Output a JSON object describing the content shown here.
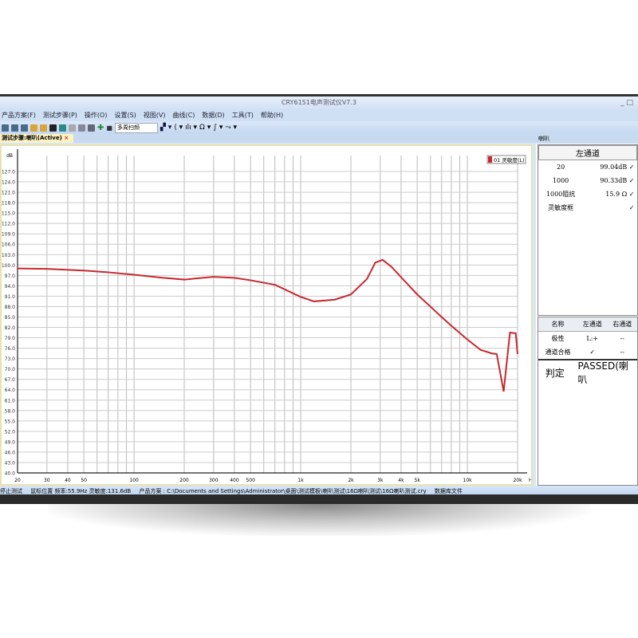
{
  "window": {
    "title": "CRY6151电声测试仪V7.3",
    "controls": "_ □"
  },
  "menu": [
    "产品方案(F)",
    "测试步骤(P)",
    "操作(O)",
    "设置(S)",
    "视图(V)",
    "曲线(C)",
    "数据(D)",
    "工具(T)",
    "帮助(H)"
  ],
  "toolbar": {
    "mode_select": "多周扫频"
  },
  "tab": {
    "label": "测试步骤:喇叭(Active)",
    "close": "×"
  },
  "right_panel": {
    "header": "喇叭",
    "results": {
      "header": "左通道",
      "rows": [
        {
          "name": "20",
          "value": "99.04dB",
          "check": "✓"
        },
        {
          "name": "1000",
          "value": "90.33dB",
          "check": "✓"
        },
        {
          "name": "1000阻抗",
          "value": "15.9 Ω",
          "check": "✓"
        },
        {
          "name": "灵敏度框",
          "value": "✓",
          "check": ""
        }
      ]
    },
    "summary": {
      "columns": [
        "名称",
        "左通道",
        "右通道"
      ],
      "rows": [
        [
          "极性",
          "L:+",
          "--"
        ],
        [
          "通道合格",
          "✓",
          "--"
        ]
      ]
    },
    "judge": {
      "label": "判定",
      "value": "PASSED(喇叭"
    }
  },
  "statusbar": {
    "state": "停止测试",
    "cursor": "鼠标位置 频率:55.9Hz 灵敏度:131.6dB",
    "product": "产品方案 : C:\\Documents and Settings\\Administrator\\桌面\\测试模板\\喇叭测试\\16Ω喇叭测试\\16Ω喇叭测试.cry",
    "db": "数据库文件"
  },
  "chart_data": {
    "type": "line",
    "xscale": "log",
    "xlim": [
      20,
      20000
    ],
    "ylim": [
      40,
      127
    ],
    "ylabel": "dB",
    "xunit": "Hz",
    "yticks": [
      "127.0",
      "124.0",
      "121.0",
      "118.0",
      "115.0",
      "112.0",
      "109.0",
      "106.0",
      "103.0",
      "100.0",
      "97.0",
      "94.0",
      "91.0",
      "88.0",
      "85.0",
      "82.0",
      "79.0",
      "76.0",
      "73.0",
      "70.0",
      "67.0",
      "64.0",
      "61.0",
      "58.0",
      "55.0",
      "52.0",
      "49.0",
      "46.0",
      "43.0",
      "40.0"
    ],
    "xticks": [
      {
        "v": 20,
        "l": "20"
      },
      {
        "v": 30,
        "l": "30"
      },
      {
        "v": 40,
        "l": "40"
      },
      {
        "v": 50,
        "l": "50"
      },
      {
        "v": 100,
        "l": "100"
      },
      {
        "v": 200,
        "l": "200"
      },
      {
        "v": 300,
        "l": "300"
      },
      {
        "v": 400,
        "l": "400"
      },
      {
        "v": 500,
        "l": "500"
      },
      {
        "v": 1000,
        "l": "1k"
      },
      {
        "v": 2000,
        "l": "2k"
      },
      {
        "v": 3000,
        "l": "3k"
      },
      {
        "v": 4000,
        "l": "4k"
      },
      {
        "v": 5000,
        "l": "5k"
      },
      {
        "v": 10000,
        "l": "10k"
      },
      {
        "v": 20000,
        "l": "20k"
      }
    ],
    "grid": true,
    "legend": "top-right",
    "color": "#c8282e",
    "series": [
      {
        "name": "01 灵敏度(L)",
        "x": [
          20,
          30,
          50,
          70,
          100,
          150,
          200,
          300,
          400,
          500,
          700,
          1000,
          1200,
          1600,
          2000,
          2500,
          2800,
          3100,
          3500,
          4000,
          5000,
          6000,
          7000,
          8000,
          10000,
          12000,
          14000,
          15000,
          16500,
          18000,
          19500,
          20000
        ],
        "y": [
          99.0,
          98.9,
          98.4,
          97.9,
          97.2,
          96.3,
          95.8,
          96.6,
          96.3,
          95.6,
          94.3,
          90.8,
          89.5,
          90.0,
          91.5,
          96.0,
          100.7,
          101.5,
          99.5,
          96.5,
          91.5,
          88.0,
          85.0,
          82.5,
          78.5,
          75.5,
          74.5,
          74.3,
          63.5,
          80.5,
          80.3,
          74.3
        ]
      }
    ]
  }
}
